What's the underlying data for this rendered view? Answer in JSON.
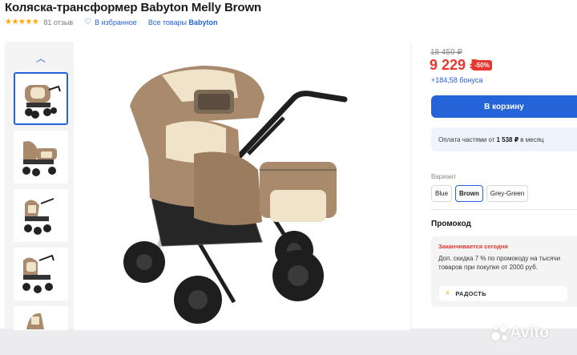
{
  "product": {
    "title": "Коляска-трансформер Babyton Melly Brown",
    "rating_stars": "★★★★★",
    "reviews": "81 отзыв",
    "favorite_label": "В избранное",
    "all_goods_prefix": "Все товары",
    "brand": "Babyton"
  },
  "gallery": {
    "thumbnails": [
      "stroller-front-view",
      "stroller-side-view",
      "stroller-three-quarter-view",
      "stroller-angle-view",
      "stroller-partial-view"
    ],
    "active_index": 0
  },
  "pricing": {
    "old_price": "18 459 ₽",
    "price": "9 229 ₽",
    "discount": "-50%",
    "bonus": "+184,58 бонуса",
    "cart_button": "В корзину",
    "installment_prefix": "Оплата частями от",
    "installment_amount": "1 538 ₽",
    "installment_suffix": "в месяц"
  },
  "variants": {
    "label": "Вариант",
    "options": [
      "Blue",
      "Brown",
      "Grey-Green"
    ],
    "selected": "Brown"
  },
  "promo": {
    "title": "Промокод",
    "ending": "Заканчивается сегодня",
    "text": "Доп. скидка 7 % по промокоду на тысячи товаров при покупке от 2000 руб.",
    "button": "РАДОСТЬ"
  },
  "watermark": "Avito",
  "colors": {
    "accent": "#2563d8",
    "price_red": "#e8372f",
    "star": "#ffa800",
    "stroller_brown": "#a98a6c",
    "stroller_cream": "#efe4c9"
  }
}
